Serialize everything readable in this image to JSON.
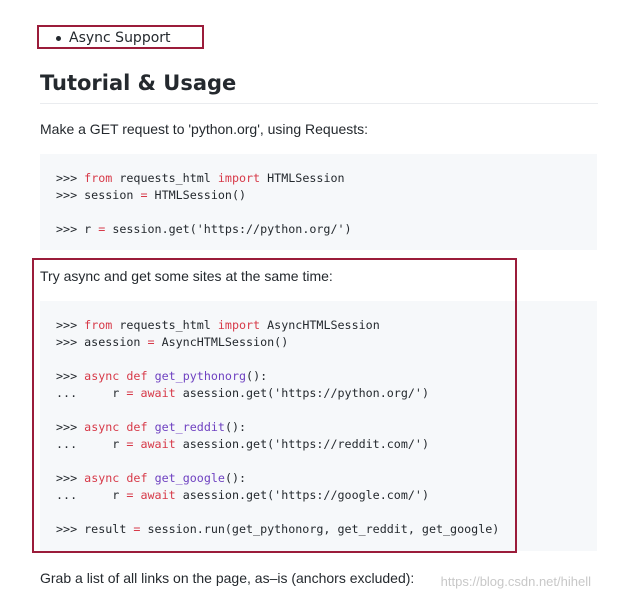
{
  "bullet": {
    "text": "Async Support"
  },
  "section": {
    "title": "Tutorial & Usage"
  },
  "para1": "Make a GET request to 'python.org', using Requests:",
  "code1": [
    [
      {
        "t": ">>> ",
        "c": "prompt"
      },
      {
        "t": "from",
        "c": "kw"
      },
      {
        "t": " requests_html ",
        "c": "prompt"
      },
      {
        "t": "import",
        "c": "kw"
      },
      {
        "t": " HTMLSession",
        "c": "prompt"
      }
    ],
    [
      {
        "t": ">>> session ",
        "c": "prompt"
      },
      {
        "t": "=",
        "c": "op"
      },
      {
        "t": " HTMLSession()",
        "c": "prompt"
      }
    ],
    [],
    [
      {
        "t": ">>> r ",
        "c": "prompt"
      },
      {
        "t": "=",
        "c": "op"
      },
      {
        "t": " session.get(",
        "c": "prompt"
      },
      {
        "t": "'https://python.org/'",
        "c": "str"
      },
      {
        "t": ")",
        "c": "prompt"
      }
    ]
  ],
  "para2": "Try async and get some sites at the same time:",
  "code2": [
    [
      {
        "t": ">>> ",
        "c": "prompt"
      },
      {
        "t": "from",
        "c": "kw"
      },
      {
        "t": " requests_html ",
        "c": "prompt"
      },
      {
        "t": "import",
        "c": "kw"
      },
      {
        "t": " AsyncHTMLSession",
        "c": "prompt"
      }
    ],
    [
      {
        "t": ">>> asession ",
        "c": "prompt"
      },
      {
        "t": "=",
        "c": "op"
      },
      {
        "t": " AsyncHTMLSession()",
        "c": "prompt"
      }
    ],
    [],
    [
      {
        "t": ">>> ",
        "c": "prompt"
      },
      {
        "t": "async",
        "c": "kw"
      },
      {
        "t": " ",
        "c": "prompt"
      },
      {
        "t": "def",
        "c": "kw"
      },
      {
        "t": " ",
        "c": "prompt"
      },
      {
        "t": "get_pythonorg",
        "c": "fn"
      },
      {
        "t": "():",
        "c": "prompt"
      }
    ],
    [
      {
        "t": "...     r ",
        "c": "prompt"
      },
      {
        "t": "=",
        "c": "op"
      },
      {
        "t": " ",
        "c": "prompt"
      },
      {
        "t": "await",
        "c": "kw"
      },
      {
        "t": " asession.get(",
        "c": "prompt"
      },
      {
        "t": "'https://python.org/'",
        "c": "str"
      },
      {
        "t": ")",
        "c": "prompt"
      }
    ],
    [],
    [
      {
        "t": ">>> ",
        "c": "prompt"
      },
      {
        "t": "async",
        "c": "kw"
      },
      {
        "t": " ",
        "c": "prompt"
      },
      {
        "t": "def",
        "c": "kw"
      },
      {
        "t": " ",
        "c": "prompt"
      },
      {
        "t": "get_reddit",
        "c": "fn"
      },
      {
        "t": "():",
        "c": "prompt"
      }
    ],
    [
      {
        "t": "...     r ",
        "c": "prompt"
      },
      {
        "t": "=",
        "c": "op"
      },
      {
        "t": " ",
        "c": "prompt"
      },
      {
        "t": "await",
        "c": "kw"
      },
      {
        "t": " asession.get(",
        "c": "prompt"
      },
      {
        "t": "'https://reddit.com/'",
        "c": "str"
      },
      {
        "t": ")",
        "c": "prompt"
      }
    ],
    [],
    [
      {
        "t": ">>> ",
        "c": "prompt"
      },
      {
        "t": "async",
        "c": "kw"
      },
      {
        "t": " ",
        "c": "prompt"
      },
      {
        "t": "def",
        "c": "kw"
      },
      {
        "t": " ",
        "c": "prompt"
      },
      {
        "t": "get_google",
        "c": "fn"
      },
      {
        "t": "():",
        "c": "prompt"
      }
    ],
    [
      {
        "t": "...     r ",
        "c": "prompt"
      },
      {
        "t": "=",
        "c": "op"
      },
      {
        "t": " ",
        "c": "prompt"
      },
      {
        "t": "await",
        "c": "kw"
      },
      {
        "t": " asession.get(",
        "c": "prompt"
      },
      {
        "t": "'https://google.com/'",
        "c": "str"
      },
      {
        "t": ")",
        "c": "prompt"
      }
    ],
    [],
    [
      {
        "t": ">>> result ",
        "c": "prompt"
      },
      {
        "t": "=",
        "c": "op"
      },
      {
        "t": " session.run(get_pythonorg, get_reddit, get_google)",
        "c": "prompt"
      }
    ]
  ],
  "para3": "Grab a list of all links on the page, as–is (anchors excluded):",
  "watermark": "https://blog.csdn.net/hihell",
  "colors": {
    "highlight_border": "#9b1c3a",
    "keyword": "#d73a49",
    "function": "#6f42c1",
    "code_bg": "#f6f8fa"
  }
}
